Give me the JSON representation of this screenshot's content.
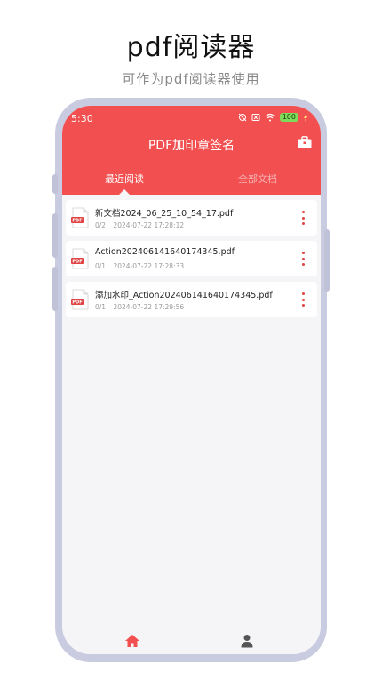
{
  "promo": {
    "title": "pdf阅读器",
    "subtitle": "可作为pdf阅读器使用"
  },
  "status_bar": {
    "time": "5:30",
    "battery": "100"
  },
  "header": {
    "title": "PDF加印章签名",
    "toolbox_icon": "toolbox-icon"
  },
  "tabs": [
    {
      "label": "最近阅读",
      "active": true
    },
    {
      "label": "全部文档",
      "active": false
    }
  ],
  "files": [
    {
      "name": "新文档2024_06_25_10_54_17.pdf",
      "pages": "0/2",
      "date": "2024-07-22 17:28:12"
    },
    {
      "name": "Action20240614164017434​5.pdf",
      "pages": "0/1",
      "date": "2024-07-22 17:28:33"
    },
    {
      "name": "添加水印_Action20240614164017434​5.pdf",
      "pages": "0/1",
      "date": "2024-07-22 17:29:56"
    }
  ],
  "bottom_nav": [
    {
      "icon": "home-icon",
      "active": true
    },
    {
      "icon": "user-icon",
      "active": false
    }
  ],
  "colors": {
    "accent": "#f25050",
    "frame": "#c9cbe0"
  }
}
